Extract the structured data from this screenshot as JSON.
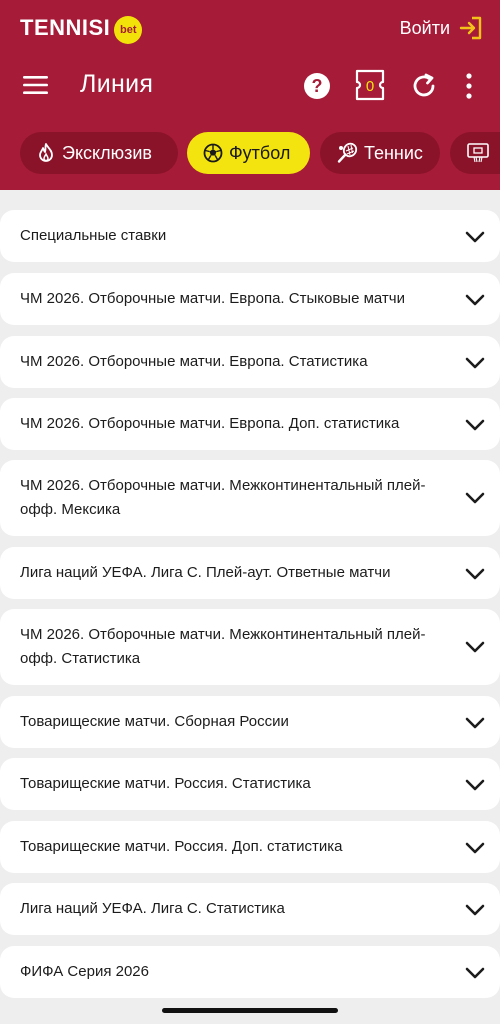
{
  "brand": {
    "name": "TENNISI",
    "badge": "bet"
  },
  "header": {
    "login_label": "Войти",
    "title": "Линия",
    "coupon_count": "0"
  },
  "categories": [
    {
      "label": "Эксклюзив",
      "icon": "flame-icon",
      "active": false
    },
    {
      "label": "Футбол",
      "icon": "soccer-ball-icon",
      "active": true
    },
    {
      "label": "Теннис",
      "icon": "tennis-racket-icon",
      "active": false
    },
    {
      "label": "",
      "icon": "basketball-hoop-icon",
      "active": false
    }
  ],
  "leagues": [
    {
      "label": "Специальные ставки"
    },
    {
      "label": "ЧМ 2026. Отборочные матчи. Европа. Стыковые матчи"
    },
    {
      "label": "ЧМ 2026. Отборочные матчи. Европа. Статистика"
    },
    {
      "label": "ЧМ 2026. Отборочные матчи. Европа. Доп. статистика"
    },
    {
      "label": "ЧМ 2026. Отборочные матчи. Межконтинентальный плей-офф. Мексика"
    },
    {
      "label": "Лига наций УЕФА. Лига С. Плей-аут. Ответные матчи"
    },
    {
      "label": "ЧМ 2026. Отборочные матчи. Межконтинентальный плей-офф. Статистика"
    },
    {
      "label": "Товарищеские матчи. Сборная России"
    },
    {
      "label": "Товарищеские матчи. Россия. Статистика"
    },
    {
      "label": "Товарищеские матчи. Россия. Доп. статистика"
    },
    {
      "label": "Лига наций УЕФА. Лига С. Статистика"
    },
    {
      "label": "ФИФА Серия 2026"
    }
  ],
  "colors": {
    "header_bg": "#a61c38",
    "chip_bg": "#8a1329",
    "active_chip": "#f3e40f",
    "page_bg": "#eeeeef"
  }
}
